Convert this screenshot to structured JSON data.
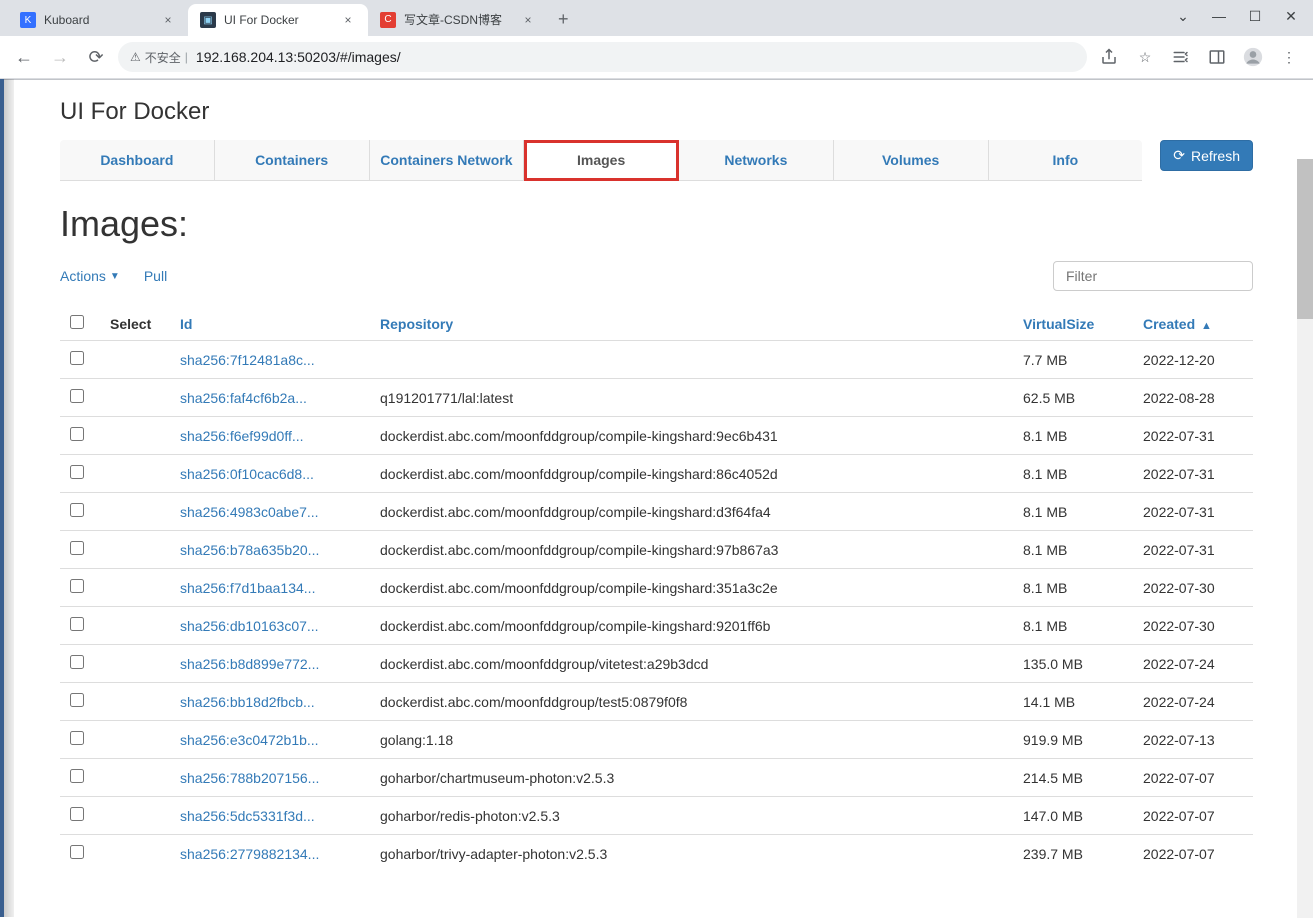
{
  "browser": {
    "tabs": [
      {
        "title": "Kuboard",
        "favicon_bg": "#3370ff",
        "favicon_txt": "K",
        "favicon_color": "#fff"
      },
      {
        "title": "UI For Docker",
        "favicon_bg": "#0db7ed",
        "favicon_txt": "▣",
        "favicon_color": "#fff"
      },
      {
        "title": "写文章-CSDN博客",
        "favicon_bg": "#e33e33",
        "favicon_txt": "C",
        "favicon_color": "#fff"
      }
    ],
    "insecure_label": "不安全",
    "url": "192.168.204.13:50203/#/images/"
  },
  "appTitle": "UI For Docker",
  "navTabs": [
    {
      "label": "Dashboard"
    },
    {
      "label": "Containers"
    },
    {
      "label": "Containers Network"
    },
    {
      "label": "Images"
    },
    {
      "label": "Networks"
    },
    {
      "label": "Volumes"
    },
    {
      "label": "Info"
    }
  ],
  "refreshLabel": "Refresh",
  "pageTitle": "Images:",
  "actions": {
    "actionsLabel": "Actions",
    "pullLabel": "Pull"
  },
  "filterPlaceholder": "Filter",
  "tableHeaders": {
    "select": "Select",
    "id": "Id",
    "repo": "Repository",
    "vsize": "VirtualSize",
    "created": "Created"
  },
  "rows": [
    {
      "id": "sha256:7f12481a8c...",
      "repo": "",
      "vsize": "7.7 MB",
      "created": "2022-12-20"
    },
    {
      "id": "sha256:faf4cf6b2a...",
      "repo": "q191201771/lal:latest",
      "vsize": "62.5 MB",
      "created": "2022-08-28"
    },
    {
      "id": "sha256:f6ef99d0ff...",
      "repo": "dockerdist.abc.com/moonfddgroup/compile-kingshard:9ec6b431",
      "vsize": "8.1 MB",
      "created": "2022-07-31"
    },
    {
      "id": "sha256:0f10cac6d8...",
      "repo": "dockerdist.abc.com/moonfddgroup/compile-kingshard:86c4052d",
      "vsize": "8.1 MB",
      "created": "2022-07-31"
    },
    {
      "id": "sha256:4983c0abe7...",
      "repo": "dockerdist.abc.com/moonfddgroup/compile-kingshard:d3f64fa4",
      "vsize": "8.1 MB",
      "created": "2022-07-31"
    },
    {
      "id": "sha256:b78a635b20...",
      "repo": "dockerdist.abc.com/moonfddgroup/compile-kingshard:97b867a3",
      "vsize": "8.1 MB",
      "created": "2022-07-31"
    },
    {
      "id": "sha256:f7d1baa134...",
      "repo": "dockerdist.abc.com/moonfddgroup/compile-kingshard:351a3c2e",
      "vsize": "8.1 MB",
      "created": "2022-07-30"
    },
    {
      "id": "sha256:db10163c07...",
      "repo": "dockerdist.abc.com/moonfddgroup/compile-kingshard:9201ff6b",
      "vsize": "8.1 MB",
      "created": "2022-07-30"
    },
    {
      "id": "sha256:b8d899e772...",
      "repo": "dockerdist.abc.com/moonfddgroup/vitetest:a29b3dcd",
      "vsize": "135.0 MB",
      "created": "2022-07-24"
    },
    {
      "id": "sha256:bb18d2fbcb...",
      "repo": "dockerdist.abc.com/moonfddgroup/test5:0879f0f8",
      "vsize": "14.1 MB",
      "created": "2022-07-24"
    },
    {
      "id": "sha256:e3c0472b1b...",
      "repo": "golang:1.18",
      "vsize": "919.9 MB",
      "created": "2022-07-13"
    },
    {
      "id": "sha256:788b207156...",
      "repo": "goharbor/chartmuseum-photon:v2.5.3",
      "vsize": "214.5 MB",
      "created": "2022-07-07"
    },
    {
      "id": "sha256:5dc5331f3d...",
      "repo": "goharbor/redis-photon:v2.5.3",
      "vsize": "147.0 MB",
      "created": "2022-07-07"
    },
    {
      "id": "sha256:2779882134...",
      "repo": "goharbor/trivy-adapter-photon:v2.5.3",
      "vsize": "239.7 MB",
      "created": "2022-07-07"
    }
  ]
}
